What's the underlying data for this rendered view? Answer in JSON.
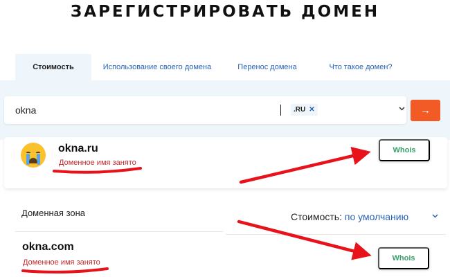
{
  "page": {
    "title": "ЗАРЕГИСТРИРОВАТЬ ДОМЕН"
  },
  "tabs": [
    {
      "label": "Стоимость",
      "active": true
    },
    {
      "label": "Использование своего домена",
      "active": false
    },
    {
      "label": "Перенос домена",
      "active": false
    },
    {
      "label": "Что такое домен?",
      "active": false
    }
  ],
  "search": {
    "value": "okna",
    "zone_chip": ".RU",
    "chip_close_glyph": "✕",
    "submit_glyph": "→"
  },
  "results": [
    {
      "domain": "okna.ru",
      "status": "Доменное имя занято",
      "whois_label": "Whois"
    },
    {
      "domain": "okna.com",
      "status": "Доменное имя занято",
      "whois_label": "Whois"
    }
  ],
  "filters": {
    "zone_label": "Доменная зона",
    "sort_label": "Стоимость:",
    "sort_value": "по умолчанию"
  },
  "icons": {
    "dropdown": "chevron-down-icon",
    "submit": "arrow-right-icon",
    "status_emoji": "crying-face-icon"
  },
  "colors": {
    "accent": "#f25a26",
    "link": "#2a63b6",
    "whois": "#3aa06a",
    "status": "#c22a2a",
    "annotation": "#e8121b",
    "panel": "#eef6fb"
  }
}
